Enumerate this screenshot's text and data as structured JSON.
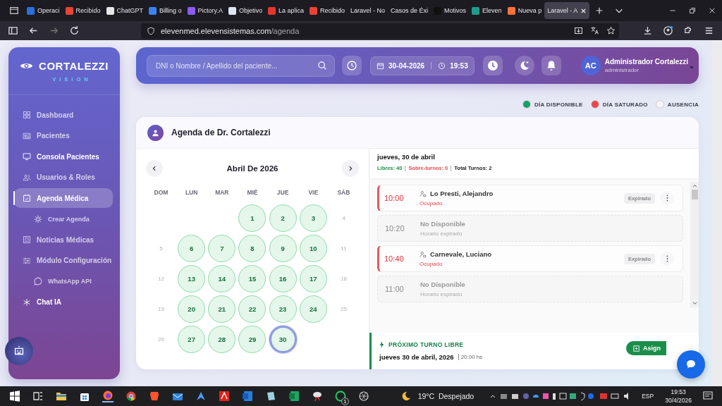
{
  "browser": {
    "tabs": [
      {
        "label": "Operaci",
        "color": "#2a6fdb",
        "selected": false
      },
      {
        "label": "Recibido",
        "color": "#ea4335",
        "selected": false
      },
      {
        "label": "ChatGPT",
        "color": "#e6e6e6",
        "selected": false
      },
      {
        "label": "Billing o",
        "color": "#3b82f6",
        "selected": false
      },
      {
        "label": "Pictory.A",
        "color": "#8b5cf6",
        "selected": false
      },
      {
        "label": "Objetivo",
        "color": "#dfe6f3",
        "selected": false
      },
      {
        "label": "La aplica",
        "color": "#e5372b",
        "selected": false
      },
      {
        "label": "Recibido",
        "color": "#ea4335",
        "selected": false
      },
      {
        "label": "Laravel - No",
        "selected": false
      },
      {
        "label": "Casos de Éxi",
        "selected": false
      },
      {
        "label": "Motivos",
        "color": "#111111",
        "selected": false
      },
      {
        "label": "Eleven",
        "color": "#1f9c8a",
        "selected": false
      },
      {
        "label": "Nueva p",
        "color": "#ff7139",
        "selected": false
      },
      {
        "label": "Laravel - A",
        "selected": true
      }
    ],
    "url_host": "elevenmed.elevensistemas.com",
    "url_path": "/agenda"
  },
  "sidebar": {
    "brand": "CORTALEZZI",
    "subtitle": "VISION",
    "items": [
      {
        "label": "Dashboard",
        "selected": false,
        "highlighted": false
      },
      {
        "label": "Pacientes",
        "selected": false,
        "highlighted": false
      },
      {
        "label": "Consola Pacientes",
        "selected": false,
        "highlighted": true
      },
      {
        "label": "Usuarios & Roles",
        "selected": false,
        "highlighted": false
      },
      {
        "label": "Agenda Médica",
        "selected": true,
        "highlighted": true,
        "children": [
          {
            "label": "Crear Agenda",
            "selected": false
          }
        ]
      },
      {
        "label": "Noticias Médicas",
        "selected": false,
        "highlighted": false
      },
      {
        "label": "Módulo Configuración",
        "selected": false,
        "highlighted": false,
        "children": [
          {
            "label": "WhatsApp API",
            "selected": false
          }
        ]
      },
      {
        "label": "Chat IA",
        "selected": false,
        "highlighted": true
      }
    ]
  },
  "header": {
    "search": {
      "placeholder": "DNI o Nombre / Apellido del paciente..."
    },
    "date": "30-04-2026",
    "time": "19:53",
    "user": {
      "initials": "AC",
      "name": "Administrador Cortalezzi",
      "role": "administrador"
    }
  },
  "legend": [
    {
      "label": "DÍA DISPONIBLE",
      "color": "#16a06a"
    },
    {
      "label": "DÍA SATURADO",
      "color": "#e5484d"
    },
    {
      "label": "AUSENCIA",
      "color": "#f4f4f6"
    }
  ],
  "agenda": {
    "title": "Agenda de Dr. Cortalezzi",
    "calendar": {
      "month": "Abril De 2026",
      "weekdays": [
        "DOM",
        "LUN",
        "MAR",
        "MIÉ",
        "JUE",
        "VIE",
        "SÁB"
      ],
      "weeks": [
        [
          {
            "kind": "empty"
          },
          {
            "kind": "empty"
          },
          {
            "kind": "empty"
          },
          {
            "kind": "disponible",
            "day": "1",
            "selected": false
          },
          {
            "kind": "disponible",
            "day": "2",
            "selected": false
          },
          {
            "kind": "disponible",
            "day": "3",
            "selected": false
          },
          {
            "kind": "plain",
            "day": "4",
            "selected": false
          }
        ],
        [
          {
            "kind": "plain",
            "day": "5",
            "selected": false
          },
          {
            "kind": "disponible",
            "day": "6",
            "selected": false
          },
          {
            "kind": "disponible",
            "day": "7",
            "selected": false
          },
          {
            "kind": "disponible",
            "day": "8",
            "selected": false
          },
          {
            "kind": "disponible",
            "day": "9",
            "selected": false
          },
          {
            "kind": "disponible",
            "day": "10",
            "selected": false
          },
          {
            "kind": "plain",
            "day": "11",
            "selected": false
          }
        ],
        [
          {
            "kind": "plain",
            "day": "12",
            "selected": false
          },
          {
            "kind": "disponible",
            "day": "13",
            "selected": false
          },
          {
            "kind": "disponible",
            "day": "14",
            "selected": false
          },
          {
            "kind": "disponible",
            "day": "15",
            "selected": false
          },
          {
            "kind": "disponible",
            "day": "16",
            "selected": false
          },
          {
            "kind": "disponible",
            "day": "17",
            "selected": false
          },
          {
            "kind": "plain",
            "day": "18",
            "selected": false
          }
        ],
        [
          {
            "kind": "plain",
            "day": "19",
            "selected": false
          },
          {
            "kind": "disponible",
            "day": "20",
            "selected": false
          },
          {
            "kind": "disponible",
            "day": "21",
            "selected": false
          },
          {
            "kind": "disponible",
            "day": "22",
            "selected": false
          },
          {
            "kind": "disponible",
            "day": "23",
            "selected": false
          },
          {
            "kind": "disponible",
            "day": "24",
            "selected": false
          },
          {
            "kind": "plain",
            "day": "25",
            "selected": false
          }
        ],
        [
          {
            "kind": "plain",
            "day": "26",
            "selected": false
          },
          {
            "kind": "disponible",
            "day": "27",
            "selected": false
          },
          {
            "kind": "disponible",
            "day": "28",
            "selected": false
          },
          {
            "kind": "disponible",
            "day": "29",
            "selected": false
          },
          {
            "kind": "disponible",
            "day": "30",
            "selected": true
          },
          {
            "kind": "empty"
          },
          {
            "kind": "empty"
          }
        ]
      ]
    },
    "day": {
      "title": "jueves, 30 de abril",
      "libres": "Libres: 40",
      "sobreturnos": "Sobre-turnos: 0",
      "total": "Total Turnos: 2"
    },
    "slots": [
      {
        "kind": "ocupado",
        "time": "10:00",
        "name": "Lo Presti, Alejandro",
        "status": "Ocupado",
        "badge": "Expirado"
      },
      {
        "kind": "no_disponible",
        "time": "10:20",
        "name": "No Disponible",
        "status": "Horario expirado"
      },
      {
        "kind": "ocupado",
        "time": "10:40",
        "name": "Carnevale, Luciano",
        "status": "Ocupado",
        "badge": "Expirado"
      },
      {
        "kind": "no_disponible",
        "time": "11:00",
        "name": "No Disponible",
        "status": "Horario expirado"
      }
    ],
    "next": {
      "title": "PRÓXIMO TURNO LIBRE",
      "date": "jueves 30 de abril, 2026",
      "time": "20:00 hs",
      "button": "Asign"
    }
  },
  "taskbar": {
    "weather": "19°C  Despejado",
    "lang": "ESP",
    "time": "19:53",
    "date": "30/4/2026",
    "whatsapp_badge": "1"
  }
}
